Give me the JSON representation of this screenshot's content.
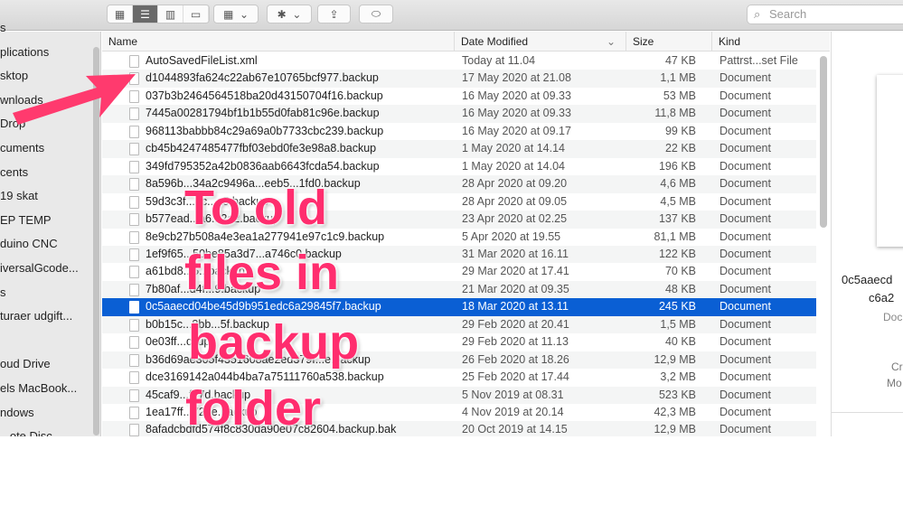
{
  "toolbar": {
    "view_icon": "icon-grid-icon",
    "view_list": "list-icon",
    "view_columns": "columns-icon",
    "view_gallery": "gallery-icon",
    "group": "group-icon",
    "action": "gear-icon",
    "share": "share-icon",
    "tag": "tag-icon",
    "search_placeholder": "Search"
  },
  "sidebar": {
    "items": [
      "s",
      "plications",
      "sktop",
      "wnloads",
      "Drop",
      "cuments",
      "cents",
      "19 skat",
      "EP TEMP",
      "duino CNC",
      "iversalGcode...",
      "s",
      "turaer udgift...",
      "",
      "oud Drive",
      "els MacBook...",
      "ndows",
      "...ote Disc"
    ]
  },
  "columns": {
    "name": "Name",
    "date": "Date Modified",
    "size": "Size",
    "kind": "Kind"
  },
  "files": [
    {
      "name": "AutoSavedFileList.xml",
      "date": "Today at 11.04",
      "size": "47 KB",
      "kind": "Pattrst...set File"
    },
    {
      "name": "d1044893fa624c22ab67e10765bcf977.backup",
      "date": "17 May 2020 at 21.08",
      "size": "1,1 MB",
      "kind": "Document"
    },
    {
      "name": "037b3b2464564518ba20d43150704f16.backup",
      "date": "16 May 2020 at 09.33",
      "size": "53 MB",
      "kind": "Document"
    },
    {
      "name": "7445a00281794bf1b1b55d0fab81c96e.backup",
      "date": "16 May 2020 at 09.33",
      "size": "11,8 MB",
      "kind": "Document"
    },
    {
      "name": "968113babbb84c29a69a0b7733cbc239.backup",
      "date": "16 May 2020 at 09.17",
      "size": "99 KB",
      "kind": "Document"
    },
    {
      "name": "cb45b4247485477fbf03ebd0fe3e98a8.backup",
      "date": "1 May 2020 at 14.14",
      "size": "22 KB",
      "kind": "Document"
    },
    {
      "name": "349fd795352a42b0836aab6643fcda54.backup",
      "date": "1 May 2020 at 14.04",
      "size": "196 KB",
      "kind": "Document"
    },
    {
      "name": "8a596b...34a2c9496a...eeb5...1fd0.backup",
      "date": "28 Apr 2020 at 09.20",
      "size": "4,6 MB",
      "kind": "Document"
    },
    {
      "name": "59d3c3f...bc...a5.backup",
      "date": "28 Apr 2020 at 09.05",
      "size": "4,5 MB",
      "kind": "Document"
    },
    {
      "name": "b577ead...a6...2a2.backup",
      "date": "23 Apr 2020 at 02.25",
      "size": "137 KB",
      "kind": "Document"
    },
    {
      "name": "8e9cb27b508a4e3ea1a277941e97c1c9.backup",
      "date": "5 Apr 2020 at 19.55",
      "size": "81,1 MB",
      "kind": "Document"
    },
    {
      "name": "1ef9f65...50be85a3d7...a746c0.backup",
      "date": "31 Mar 2020 at 16.11",
      "size": "122 KB",
      "kind": "Document"
    },
    {
      "name": "a61bd8...5...backup",
      "date": "29 Mar 2020 at 17.41",
      "size": "70 KB",
      "kind": "Document"
    },
    {
      "name": "7b80af...d4f...9.backup",
      "date": "21 Mar 2020 at 09.35",
      "size": "48 KB",
      "kind": "Document"
    },
    {
      "name": "0c5aaecd04be45d9b951edc6a29845f7.backup",
      "date": "18 Mar 2020 at 13.11",
      "size": "245 KB",
      "kind": "Document",
      "selected": true
    },
    {
      "name": "b0b15c...8bb...5f.backup",
      "date": "29 Feb 2020 at 20.41",
      "size": "1,5 MB",
      "kind": "Document"
    },
    {
      "name": "0e03ff...ckup",
      "date": "29 Feb 2020 at 11.13",
      "size": "40 KB",
      "kind": "Document"
    },
    {
      "name": "b36d69ae305f4351608ae2ed379f...e.backup",
      "date": "26 Feb 2020 at 18.26",
      "size": "12,9 MB",
      "kind": "Document"
    },
    {
      "name": "dce3169142a044b4ba7a75111760a538.backup",
      "date": "25 Feb 2020 at 17.44",
      "size": "3,2 MB",
      "kind": "Document"
    },
    {
      "name": "45caf9...f77d.backup",
      "date": "5 Nov 2019 at 08.31",
      "size": "523 KB",
      "kind": "Document"
    },
    {
      "name": "1ea17ff...723e.backup",
      "date": "4 Nov 2019 at 20.14",
      "size": "42,3 MB",
      "kind": "Document"
    },
    {
      "name": "8afadcbdfd574f8c830da90e07c82604.backup.bak",
      "date": "20 Oct 2019 at 14.15",
      "size": "12,9 MB",
      "kind": "Document"
    }
  ],
  "preview": {
    "name_line1": "0c5aaecd",
    "name_line2": "c6a2",
    "kind": "Doc",
    "created": "Cr",
    "modified": "Mo"
  },
  "annotation": {
    "lines": [
      "To old",
      "files in",
      "backup",
      "folder"
    ],
    "color": "#ff2d6e"
  },
  "colors": {
    "selection": "#0a5fd4"
  }
}
